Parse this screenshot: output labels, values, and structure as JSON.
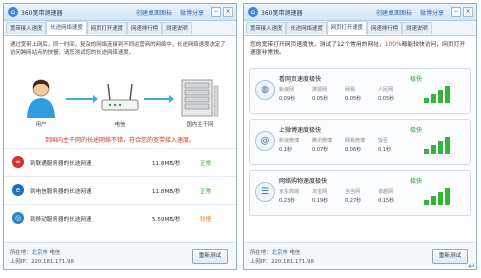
{
  "colors": {
    "accent": "#2b6cb3",
    "ok": "#2fa12b",
    "warn": "#cc3b1f",
    "bar": "#34b53a"
  },
  "left": {
    "app_title": "360宽带测速器",
    "link_desktop": "创建桌面图标",
    "link_share": "微博分享",
    "tabs": [
      "宽带接入速度",
      "长途网络速度",
      "网页打开速度",
      "网速排行榜",
      "测速说明"
    ],
    "active_tab": 1,
    "intro": "通过宽带上网后，同一时间，复杂的网络连接到不同运营商的网络中，长途网络速度决定了访问跨网站点的快慢，请您测试您的长途网络速度。",
    "diagram": {
      "user": "用户",
      "modem": "电信",
      "servers": "国内主干网"
    },
    "status": "到国内主干网的长途网络不错，符合您的宽带接入速度。",
    "isp_rows": [
      {
        "icon": "unicom-icon",
        "label": "到联通服务器的长途网速",
        "speed": "11.8MB/秒",
        "state": "正常",
        "state_color": "#2fa12b",
        "icon_color": "#d6332a",
        "glyph": "∞"
      },
      {
        "icon": "telecom-icon",
        "label": "到电信服务器的长途网速",
        "speed": "11.8MB/秒",
        "state": "正常",
        "state_color": "#2fa12b",
        "icon_color": "#1f6fc0",
        "glyph": "e"
      },
      {
        "icon": "mobile-icon",
        "label": "到移动服务器的长途网速",
        "speed": "5.59MB/秒",
        "state": "较慢",
        "state_color": "#e07a1f",
        "icon_color": "#2a84c6",
        "glyph": "◎"
      }
    ],
    "footer": {
      "location_prefix": "所在地：",
      "location": "北京市",
      "isp": "电信",
      "ip": "上网IP：220.181.171.98",
      "retest": "重新测试"
    }
  },
  "right": {
    "app_title": "360宽带测速器",
    "link_desktop": "创建桌面图标",
    "link_share": "微博分享",
    "tabs": [
      "宽带接入速度",
      "长途网络速度",
      "网页打开速度",
      "网速排行榜",
      "测速说明"
    ],
    "active_tab": 2,
    "intro_pre": "您的宽带打开网页速度快，测试了12个常用的网址，",
    "intro_highlight": "100%",
    "intro_post": "都能较快访问，网页打开速度非常快。",
    "cards": [
      {
        "icon": "globe-icon",
        "glyph": "◍",
        "title": "看网页速度极快",
        "status": "极快",
        "labels": [
          "新浪网",
          "搜狐网",
          "网易",
          "人民网"
        ],
        "values": [
          "0.09秒",
          "0.05秒",
          "0.05秒",
          "0.05秒"
        ],
        "signal": 4
      },
      {
        "icon": "at-icon",
        "glyph": "@",
        "title": "上微博速度极快",
        "status": "极快",
        "labels": [
          "新浪微博",
          "腾讯微博",
          "网易微博",
          "饭否"
        ],
        "values": [
          "0.1秒",
          "0.07秒",
          "0.06秒",
          "0.1秒"
        ],
        "signal": 4
      },
      {
        "icon": "cart-icon",
        "glyph": "☰",
        "title": "网络购物速度极快",
        "status": "极快",
        "labels": [
          "京东商城",
          "淘宝网",
          "当当网",
          "卓越网"
        ],
        "values": [
          "0.23秒",
          "0.19秒",
          "0.27秒",
          "0.15秒"
        ],
        "signal": 4
      }
    ],
    "footer": {
      "location_prefix": "所在地：",
      "location": "北京市",
      "isp": "电信",
      "ip": "上网IP：220.181.171.98",
      "retest": "重新测试"
    }
  }
}
